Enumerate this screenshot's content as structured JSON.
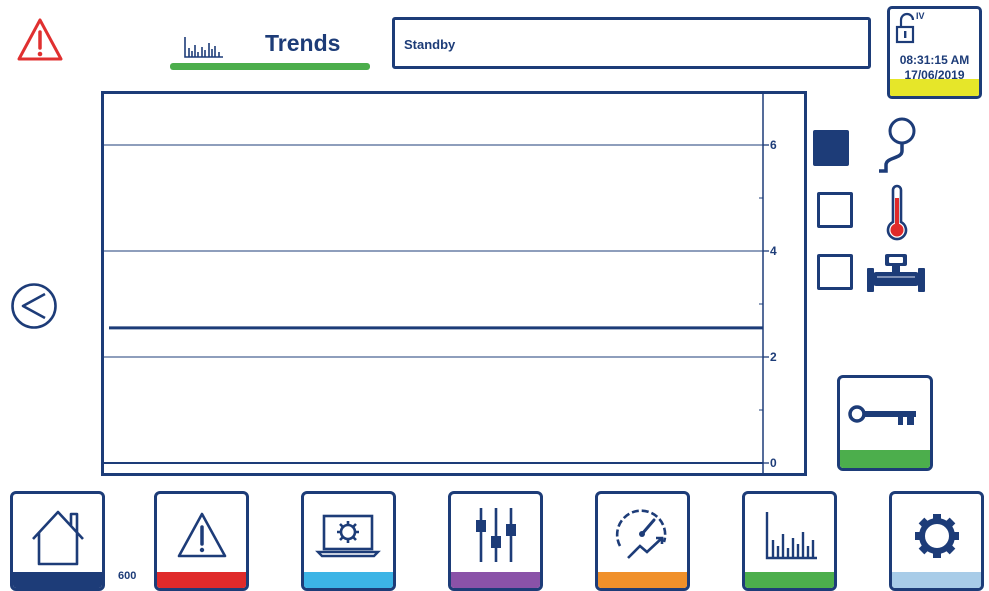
{
  "header": {
    "title": "Trends",
    "status": "Standby",
    "access_level": "IV",
    "time": "08:31:15 AM",
    "date": "17/06/2019"
  },
  "chart_data": {
    "type": "line",
    "y_ticks": [
      "0",
      "2",
      "4",
      "6"
    ],
    "ylim": [
      0,
      7
    ],
    "grid": true,
    "series": [
      {
        "color": "#1d3c78",
        "values": [
          2.55,
          2.55
        ]
      }
    ]
  },
  "selectors": [
    {
      "sensor": "pressure-sensor",
      "checked": true
    },
    {
      "sensor": "temperature-sensor",
      "checked": false
    },
    {
      "sensor": "flow-meter",
      "checked": false
    }
  ],
  "screen_number": "600",
  "nav": [
    {
      "name": "home",
      "strip_color": "#1d3c78"
    },
    {
      "name": "alarms",
      "strip_color": "#e02a2a"
    },
    {
      "name": "system",
      "strip_color": "#3cb4e6"
    },
    {
      "name": "settings",
      "strip_color": "#8a52a8"
    },
    {
      "name": "performance",
      "strip_color": "#f0902a"
    },
    {
      "name": "trends",
      "strip_color": "#4cae4c"
    },
    {
      "name": "configuration",
      "strip_color": "#a8cce8"
    }
  ],
  "colors": {
    "navy": "#1d3c78",
    "alarm_red": "#e03030",
    "active_green": "#4cae4c",
    "lock_yellow": "#e6e629"
  }
}
